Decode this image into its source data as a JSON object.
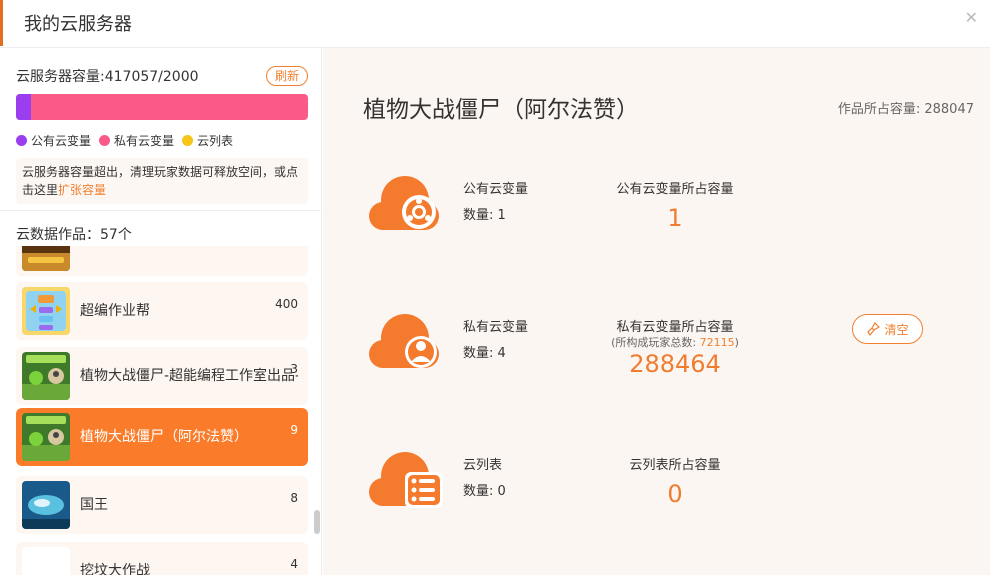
{
  "header": {
    "title": "我的云服务器",
    "close_icon": "close-icon"
  },
  "capacity": {
    "label": "云服务器容量:417057/2000",
    "refresh_label": "刷新",
    "bar": {
      "public_color": "#9a3ef0",
      "private_color": "#fa5a88",
      "public_fraction": 0.05
    },
    "legend": [
      {
        "label": "公有云变量",
        "color": "#9a3ef0"
      },
      {
        "label": "私有云变量",
        "color": "#fa5a88"
      },
      {
        "label": "云列表",
        "color": "#f5c518"
      }
    ],
    "notice_text": "云服务器容量超出，清理玩家数据可释放空间，或点击这里",
    "notice_link": "扩张容量"
  },
  "works": {
    "count_label": "云数据作品：57个",
    "items": [
      {
        "name": "",
        "num": "",
        "active": false
      },
      {
        "name": "超编作业帮",
        "num": "400",
        "active": false
      },
      {
        "name": "植物大战僵尸-超能编程工作室出品-1",
        "num": "3",
        "active": false
      },
      {
        "name": "植物大战僵尸（阿尔法赞）",
        "num": "9",
        "active": true
      },
      {
        "name": "国王",
        "num": "8",
        "active": false
      },
      {
        "name": "挖坟大作战",
        "num": "4",
        "active": false
      }
    ]
  },
  "project": {
    "title": "植物大战僵尸（阿尔法赞）",
    "capacity_label": "作品所占容量: 288047",
    "rows": [
      {
        "icon": "cloud-public-icon",
        "label": "公有云变量",
        "count": "数量: 1",
        "cap_label": "公有云变量所占容量",
        "cap_sub_prefix": "",
        "cap_sub_value": "",
        "cap_sub_suffix": "",
        "cap_value": "1"
      },
      {
        "icon": "cloud-private-icon",
        "label": "私有云变量",
        "count": "数量: 4",
        "cap_label": "私有云变量所占容量",
        "cap_sub_prefix": "(所构成玩家总数: ",
        "cap_sub_value": "72115",
        "cap_sub_suffix": ")",
        "cap_value": "288464",
        "clear_label": "清空"
      },
      {
        "icon": "cloud-list-icon",
        "label": "云列表",
        "count": "数量: 0",
        "cap_label": "云列表所占容量",
        "cap_sub_prefix": "",
        "cap_sub_value": "",
        "cap_sub_suffix": "",
        "cap_value": "0"
      }
    ]
  },
  "colors": {
    "accent": "#f07c30",
    "active_item": "#fa7c2a",
    "panel_bg": "#fcf6f2"
  }
}
